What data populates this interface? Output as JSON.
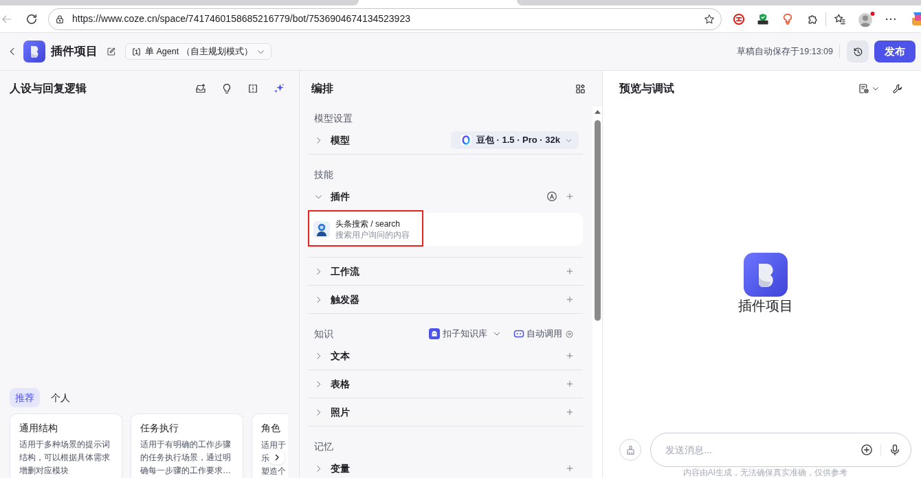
{
  "browser": {
    "url": "https://www.coze.cn/space/7417460158685216779/bot/7536904674134523923"
  },
  "header": {
    "title": "插件项目",
    "mode": "单 Agent （自主规划模式）",
    "save_status": "草稿自动保存于19:13:09",
    "publish": "发布"
  },
  "persona_panel": {
    "title": "人设与回复逻辑",
    "template_tabs": [
      {
        "label": "推荐",
        "selected": true
      },
      {
        "label": "个人",
        "selected": false
      }
    ],
    "templates": [
      {
        "kind": "full",
        "title": "通用结构",
        "lines": [
          "适用于多种场景的提示词",
          "结构，可以根据具体需求",
          "增删对应模块"
        ]
      },
      {
        "kind": "full",
        "title": "任务执行",
        "lines": [
          "适用于有明确的工作步骤",
          "的任务执行场景，通过明",
          "确每一步骤的工作要求…"
        ]
      },
      {
        "kind": "clipped",
        "title": "角色",
        "lines": [
          "适用于",
          "乐",
          "塑造个"
        ]
      }
    ]
  },
  "arrange_panel": {
    "title": "编排",
    "sections": [
      {
        "label": "模型设置",
        "rows": [
          {
            "kind": "model",
            "label": "模型",
            "expanded": false,
            "model": "豆包 · 1.5 · Pro · 32k"
          }
        ]
      },
      {
        "label": "技能",
        "rows": [
          {
            "kind": "plugins",
            "label": "插件",
            "expanded": true,
            "plugins": [
              {
                "name": "头条搜索 / search",
                "description": "搜索用户询问的内容",
                "highlighted": true
              }
            ]
          },
          {
            "kind": "plain",
            "label": "工作流",
            "expanded": false
          },
          {
            "kind": "plain",
            "label": "触发器",
            "expanded": false
          }
        ]
      },
      {
        "label": "知识",
        "source": "扣子知识库",
        "call_mode": "自动调用",
        "rows": [
          {
            "kind": "plain",
            "label": "文本",
            "expanded": false
          },
          {
            "kind": "plain",
            "label": "表格",
            "expanded": false
          },
          {
            "kind": "plain",
            "label": "照片",
            "expanded": false
          }
        ]
      },
      {
        "label": "记忆",
        "rows": [
          {
            "kind": "plain",
            "label": "变量",
            "expanded": false
          }
        ]
      }
    ]
  },
  "preview_panel": {
    "title": "预览与调试",
    "bot_name": "插件项目",
    "message_input": {
      "placeholder": "发送消息..."
    },
    "disclaimer": "内容由AI生成，无法确保真实准确，仅供参考"
  }
}
